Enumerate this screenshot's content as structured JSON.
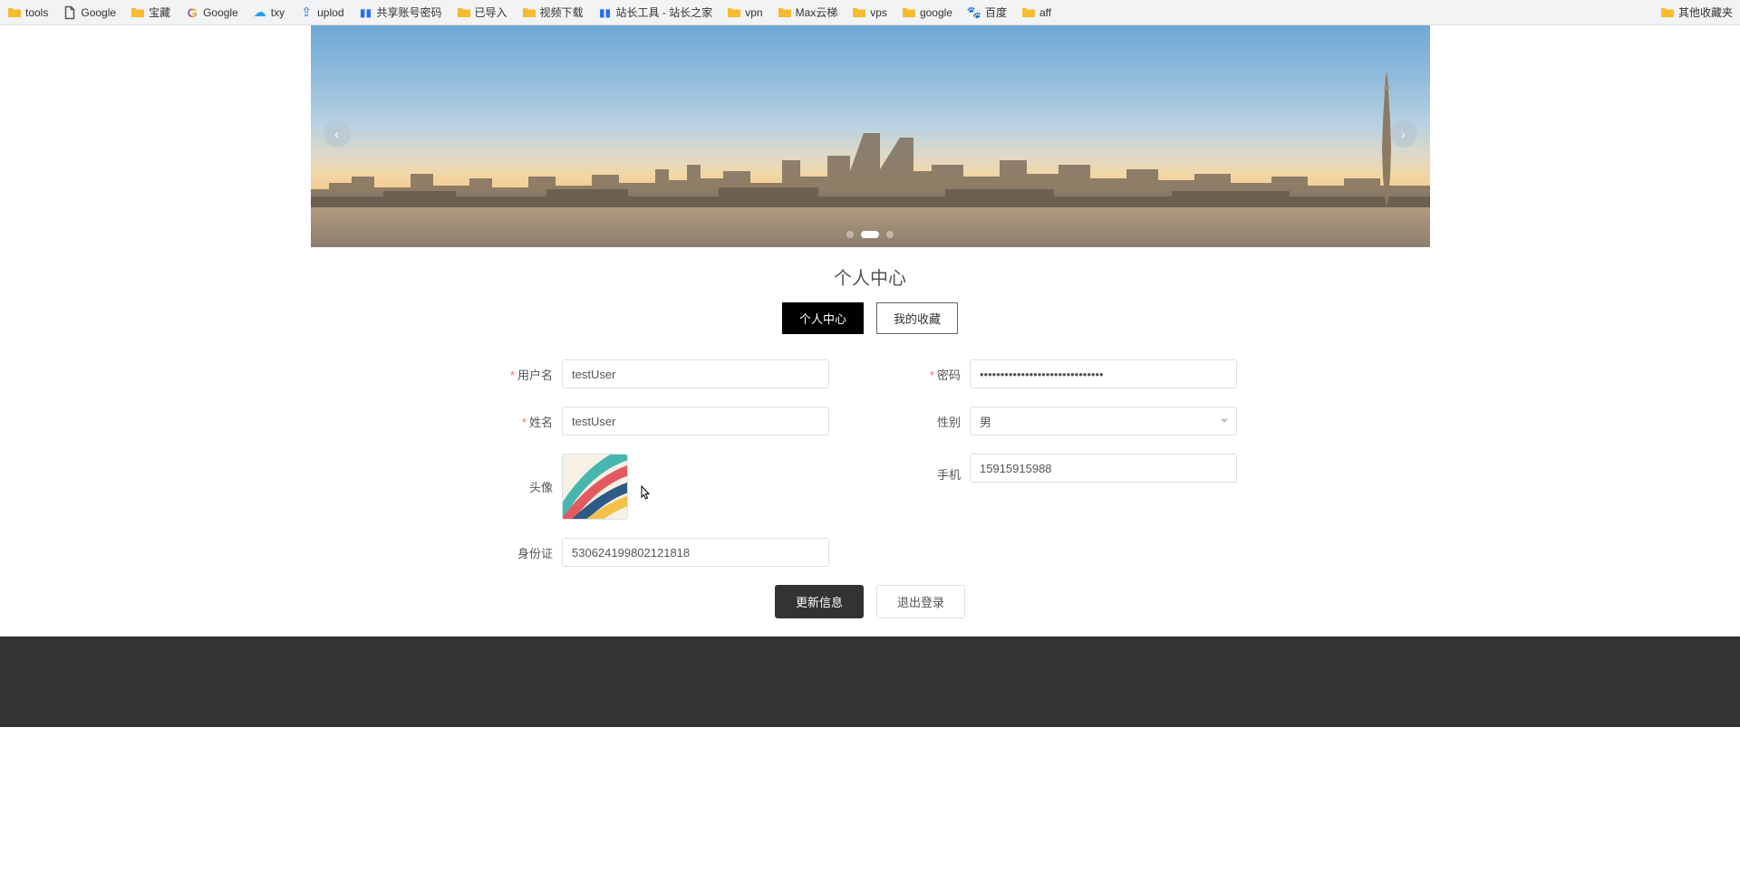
{
  "bookmarks": {
    "left": [
      {
        "label": "tools",
        "icon": "folder"
      },
      {
        "label": "Google",
        "icon": "page"
      },
      {
        "label": "宝藏",
        "icon": "folder"
      },
      {
        "label": "Google",
        "icon": "g"
      },
      {
        "label": "txy",
        "icon": "cloud"
      },
      {
        "label": "uplod",
        "icon": "share"
      },
      {
        "label": "共享账号密码",
        "icon": "tool"
      },
      {
        "label": "已导入",
        "icon": "folder"
      },
      {
        "label": "视频下载",
        "icon": "folder"
      },
      {
        "label": "站长工具 - 站长之家",
        "icon": "tool"
      },
      {
        "label": "vpn",
        "icon": "folder"
      },
      {
        "label": "Max云梯",
        "icon": "folder"
      },
      {
        "label": "vps",
        "icon": "folder"
      },
      {
        "label": "google",
        "icon": "folder"
      },
      {
        "label": "百度",
        "icon": "paw"
      },
      {
        "label": "aff",
        "icon": "folder"
      }
    ],
    "right": {
      "label": "其他收藏夹",
      "icon": "folder"
    }
  },
  "carousel": {
    "dots": 3,
    "active": 1
  },
  "page_title": "个人中心",
  "tabs": [
    {
      "label": "个人中心",
      "active": true
    },
    {
      "label": "我的收藏",
      "active": false
    }
  ],
  "form": {
    "username_label": "用户名",
    "username_value": "testUser",
    "password_label": "密码",
    "password_value": "••••••••••••••••••••••••••••••",
    "name_label": "姓名",
    "name_value": "testUser",
    "gender_label": "性别",
    "gender_value": "男",
    "avatar_label": "头像",
    "phone_label": "手机",
    "phone_value": "15915915988",
    "idcard_label": "身份证",
    "idcard_value": "530624199802121818"
  },
  "buttons": {
    "update": "更新信息",
    "logout": "退出登录"
  }
}
